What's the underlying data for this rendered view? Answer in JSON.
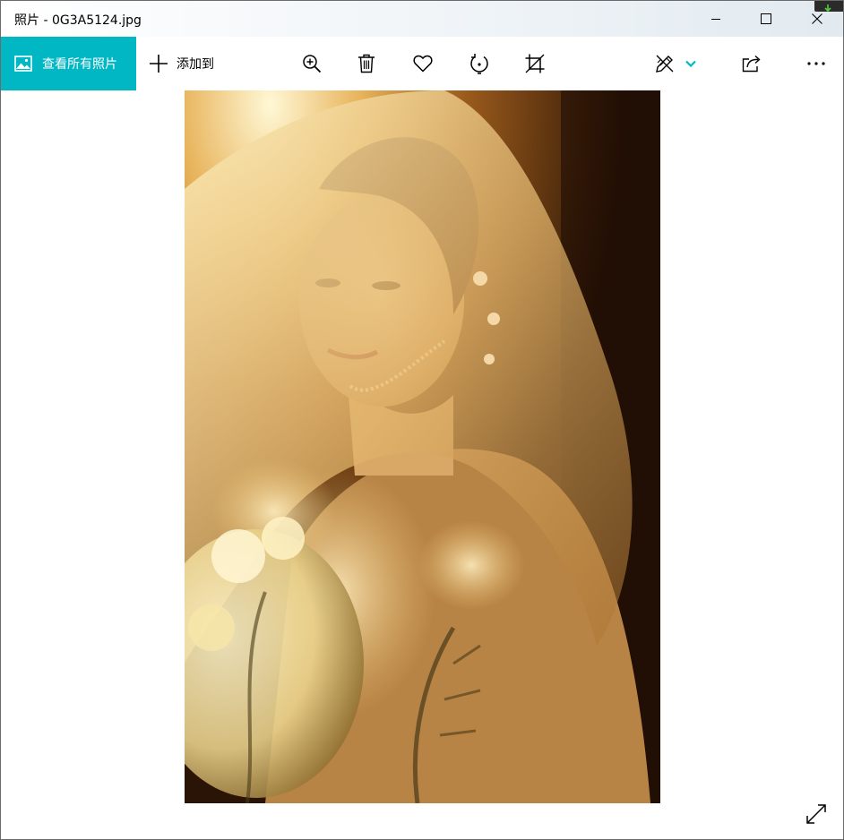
{
  "window": {
    "title": "照片 - 0G3A5124.jpg"
  },
  "toolbar": {
    "see_all_label": "查看所有照片",
    "add_to_label": "添加到",
    "accent_color": "#00b7c3"
  },
  "icons": {
    "see_all": "picture-icon",
    "add_to": "plus-icon",
    "zoom": "zoom-in-icon",
    "delete": "trash-icon",
    "favorite": "heart-icon",
    "rotate": "rotate-icon",
    "crop": "crop-icon",
    "edit": "edit-create-icon",
    "share": "share-icon",
    "more": "more-icon",
    "expand": "expand-icon"
  }
}
